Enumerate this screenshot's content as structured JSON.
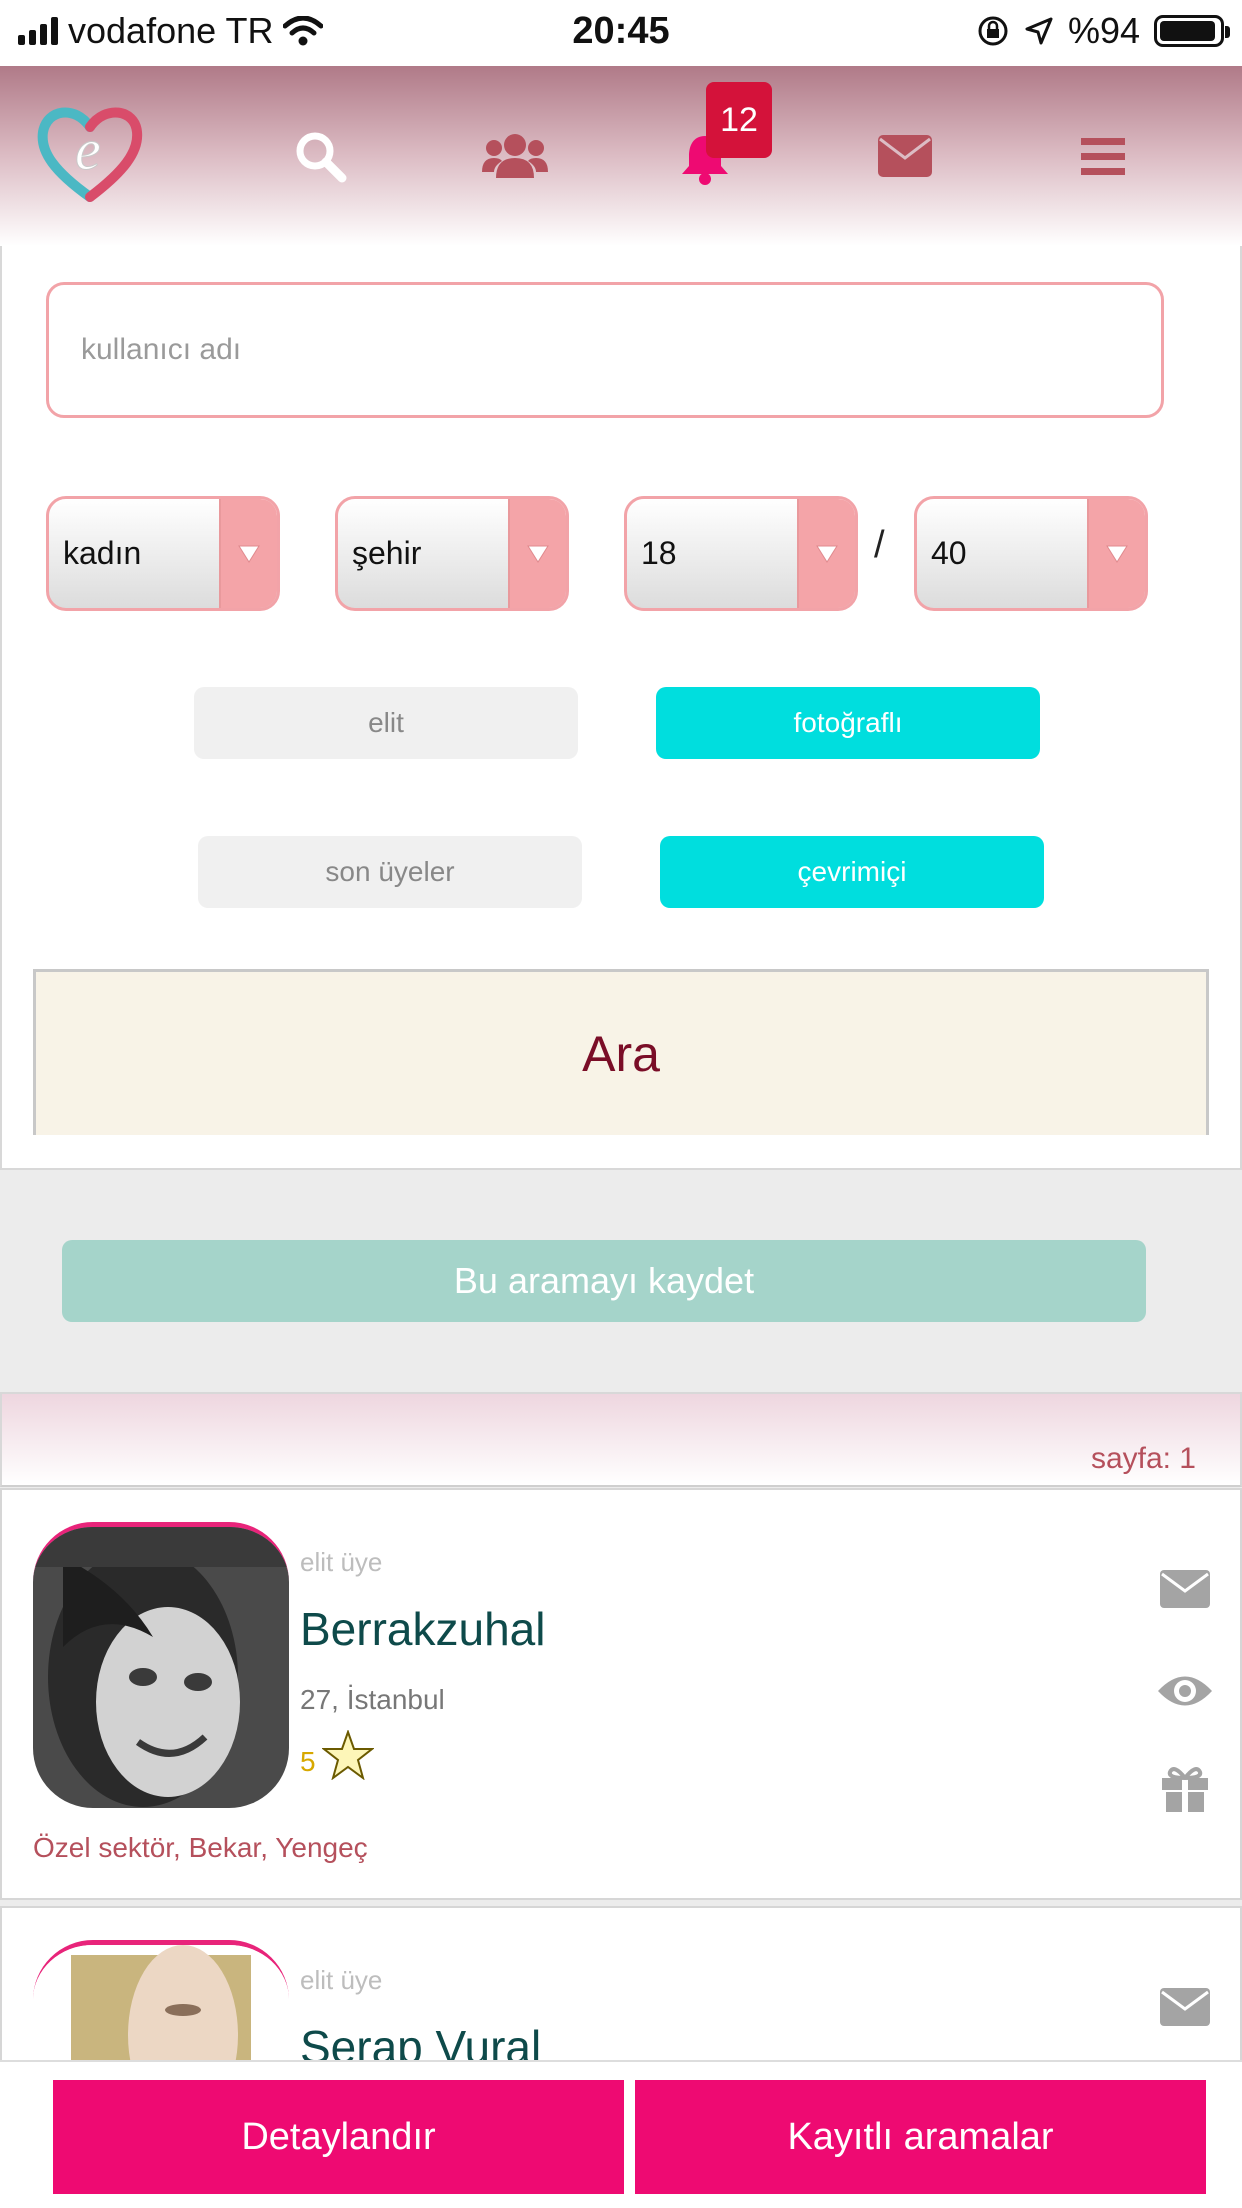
{
  "status_bar": {
    "carrier": "vodafone TR",
    "time": "20:45",
    "battery": "%94",
    "battery_level": 0.94
  },
  "nav": {
    "notification_count": "12",
    "items": [
      "logo-icon",
      "search-icon",
      "users-icon",
      "bell-icon",
      "envelope-icon",
      "menu-icon"
    ]
  },
  "search": {
    "username_placeholder": "kullanıcı adı",
    "gender": "kadın",
    "city": "şehir",
    "age_min": "18",
    "age_separator": "/",
    "age_max": "40",
    "filters": {
      "elit": "elit",
      "photo": "fotoğraflı",
      "new_members": "son üyeler",
      "online": "çevrimiçi"
    },
    "submit": "Ara",
    "save": "Bu aramayı kaydet"
  },
  "results": {
    "page_label": "sayfa: 1",
    "items": [
      {
        "tag": "elit üye",
        "name": "Berrakzuhal",
        "age_city": "27, İstanbul",
        "score": "5",
        "info": "Özel sektör, Bekar, Yengeç"
      },
      {
        "tag": "elit üye",
        "name": "Serap Vural"
      }
    ]
  },
  "bottom": {
    "detail": "Detaylandır",
    "saved": "Kayıtlı aramalar"
  },
  "colors": {
    "accent": "#ee0a72",
    "cyan": "#00dede",
    "nav_icon": "#b5505c",
    "save_button": "#a5d4ca"
  }
}
